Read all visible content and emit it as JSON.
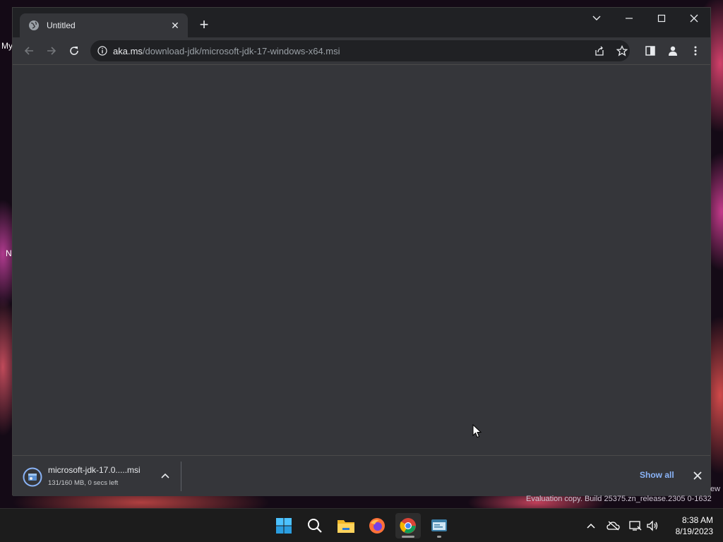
{
  "desktop": {
    "labels": [
      "My",
      "N"
    ]
  },
  "browser": {
    "tab": {
      "title": "Untitled",
      "close_glyph": "✕"
    },
    "new_tab_glyph": "+",
    "url": {
      "host": "aka.ms",
      "path": "/download-jdk/microsoft-jdk-17-windows-x64.msi"
    },
    "downloads": {
      "item": {
        "name": "microsoft-jdk-17.0.....msi",
        "status": "131/160 MB, 0 secs left"
      },
      "show_all_label": "Show all"
    }
  },
  "watermark": {
    "text": "Evaluation copy. Build 25375.zn_release.2305 0-1632",
    "edge_text": "ew"
  },
  "taskbar": {
    "apps": [
      "start-icon",
      "search-icon",
      "file-explorer-icon",
      "firefox-icon",
      "chrome-icon",
      "terminal-icon"
    ],
    "clock": {
      "time": "8:38 AM",
      "date": "8/19/2023"
    }
  },
  "colors": {
    "link": "#8ab4f8",
    "toolbar": "#35363a",
    "tabstrip": "#202124"
  }
}
